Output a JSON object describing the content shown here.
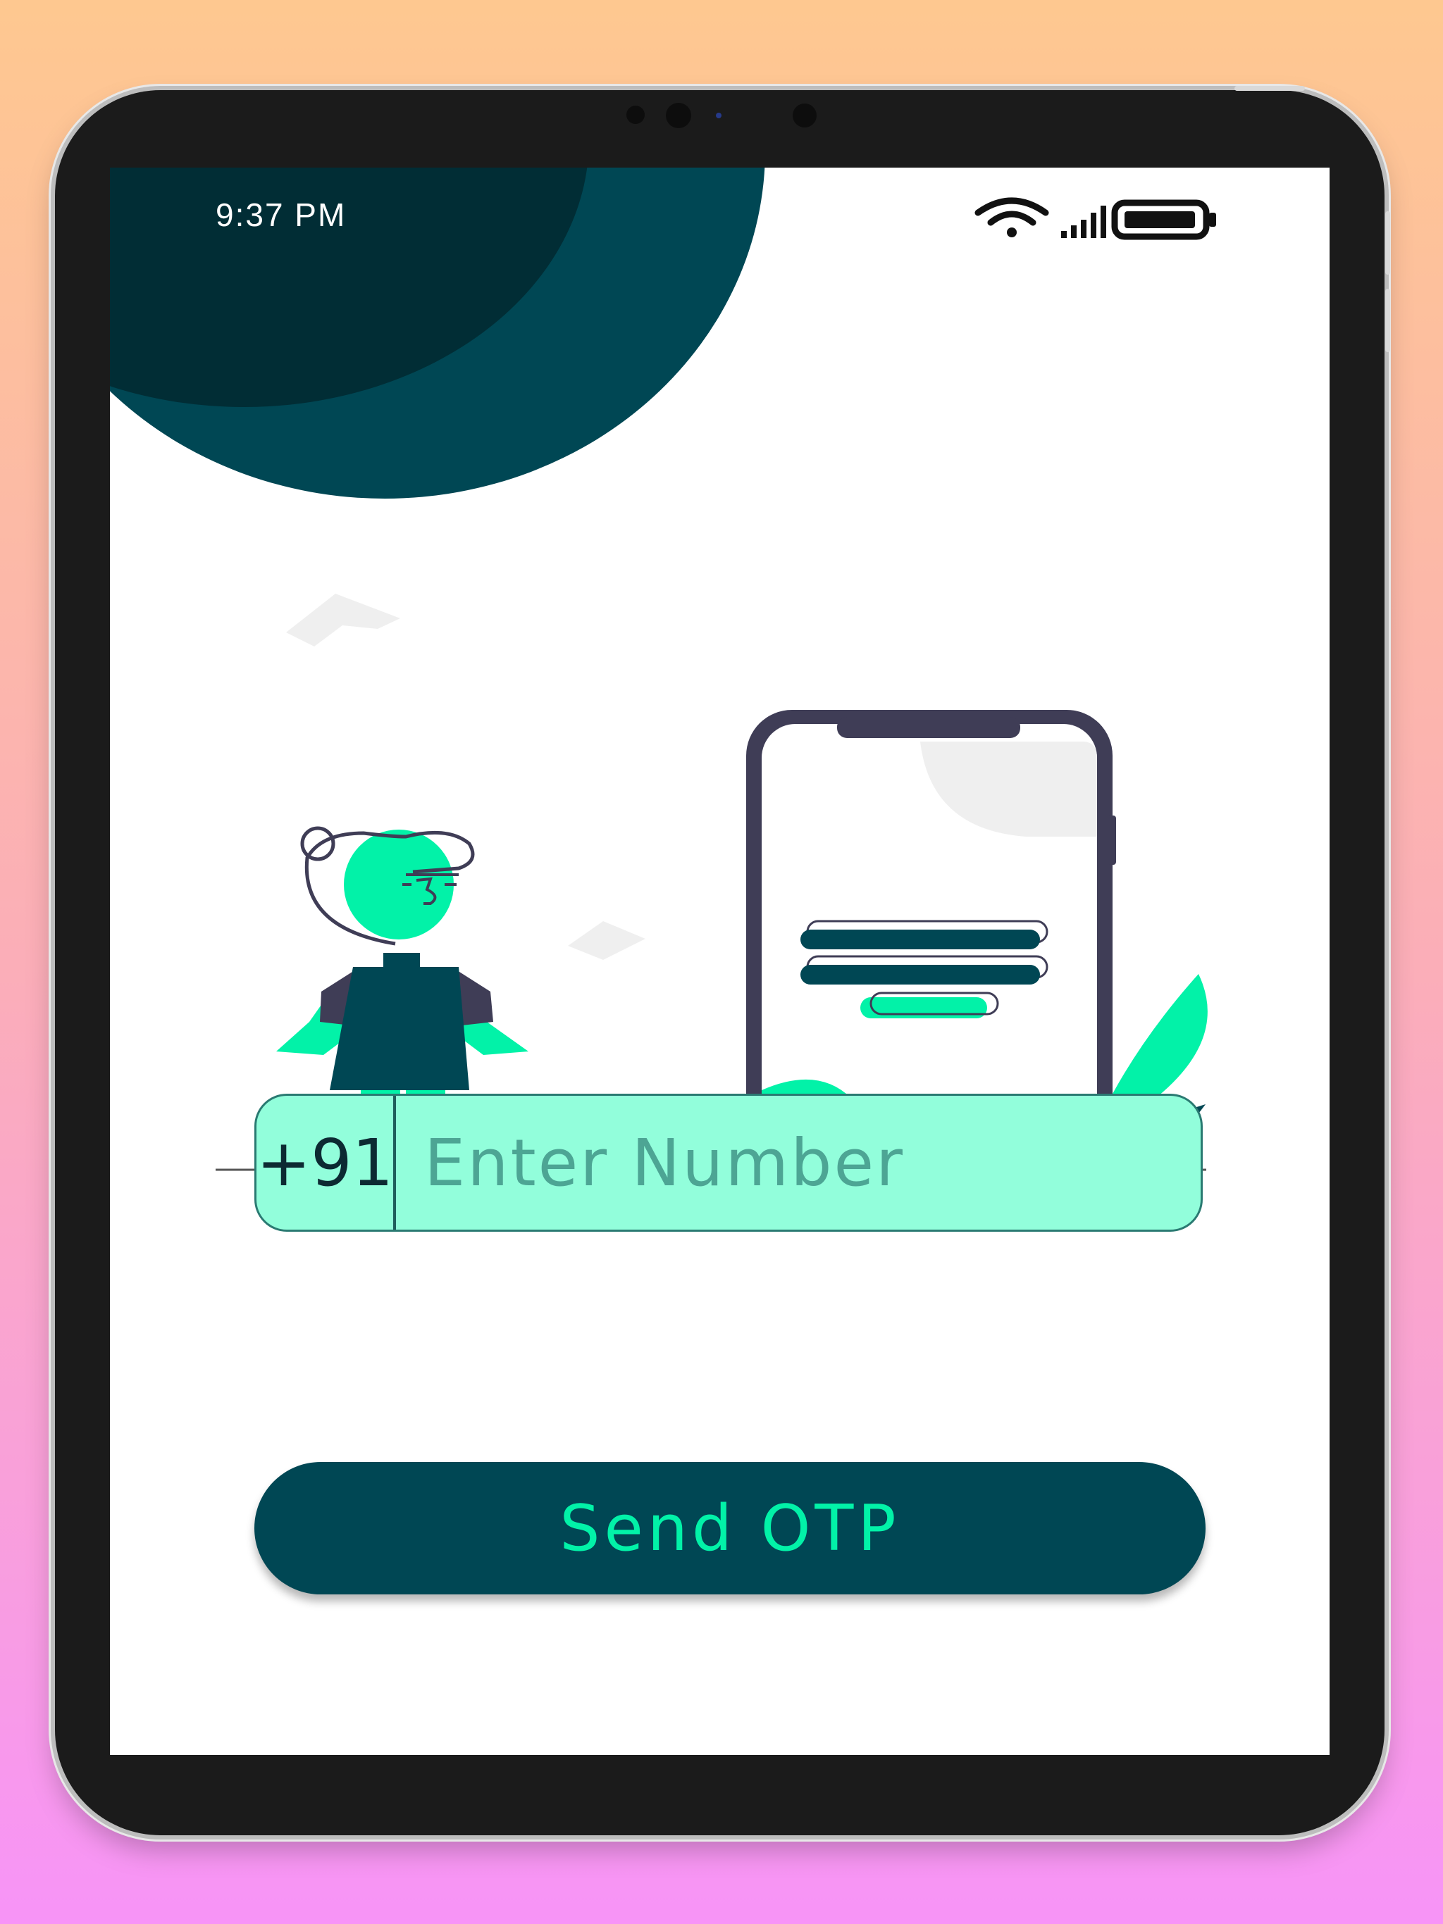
{
  "status_bar": {
    "time": "9:37 PM",
    "icons": [
      "wifi-icon",
      "signal-icon",
      "battery-icon"
    ]
  },
  "illustration": {
    "name": "person-with-phone-illustration"
  },
  "phone_input": {
    "country_code": "+91",
    "placeholder": "Enter Number",
    "value": ""
  },
  "send_button": {
    "label": "Send OTP"
  },
  "colors": {
    "accent": "#02f2a8",
    "dark_teal": "#004754",
    "input_bg": "#92fedb",
    "bg_gradient_top": "#fec890",
    "bg_gradient_bottom": "#f794f7"
  }
}
